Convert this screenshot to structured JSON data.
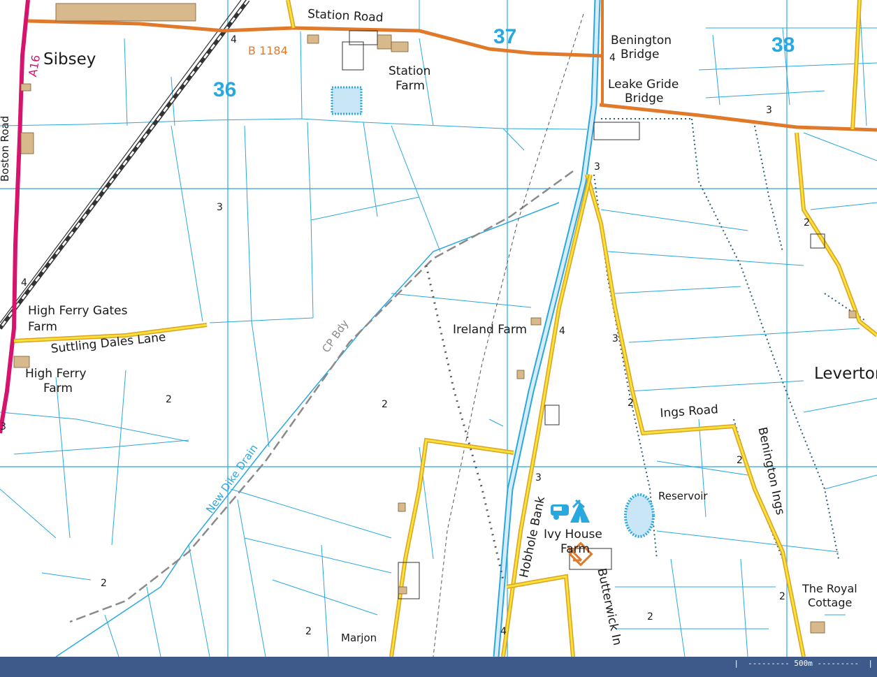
{
  "map": {
    "places": {
      "sibsey": "Sibsey",
      "station_road": "Station Road",
      "station_farm_1": "Station",
      "station_farm_2": "Farm",
      "benington_bridge_1": "Benington",
      "benington_bridge_2": "Bridge",
      "leake_gride_1": "Leake Gride",
      "leake_gride_2": "Bridge",
      "high_ferry_gates_1": "High Ferry Gates",
      "high_ferry_gates_2": "Farm",
      "suttling_dales_lane": "Suttling Dales Lane",
      "high_ferry_farm_1": "High Ferry",
      "high_ferry_farm_2": "Farm",
      "ireland_farm": "Ireland Farm",
      "leverton": "Leverton",
      "ings_road": "Ings Road",
      "benington_ings": "Benington Ings",
      "reservoir": "Reservoir",
      "ivy_house_farm_1": "Ivy House",
      "ivy_house_farm_2": "Farm",
      "hobhole_bank": "Hobhole Bank",
      "butterwick_ings": "Butterwick In",
      "royal_cottage_1": "The Royal",
      "royal_cottage_2": "Cottage",
      "marjon": "Marjon",
      "boston_road": "Boston Road"
    },
    "roads": {
      "a16": "A16",
      "b1184": "B 1184"
    },
    "water_labels": {
      "new_dike_drain": "New Dike Drain"
    },
    "boundary_labels": {
      "cp_bdy": "CP Bdy"
    },
    "grid_numbers": [
      "36",
      "37",
      "38"
    ],
    "spot_heights": [
      "4",
      "4",
      "3",
      "3",
      "4",
      "3",
      "2",
      "2",
      "2",
      "3",
      "2",
      "2",
      "2",
      "2",
      "2",
      "2",
      "4",
      "3",
      "3",
      "4",
      "2"
    ],
    "icons": [
      "caravan-campsite-icon",
      "viewpoint-icon"
    ],
    "colors": {
      "water_lines": "#29a8e0",
      "b_road": "#e07a2a",
      "a_road": "#d6146e",
      "minor_road": "#f5e23a",
      "grid_numbers": "#29a8e0",
      "footer": "#3d5a8a"
    }
  },
  "footer": {
    "scale_label": "500m"
  }
}
